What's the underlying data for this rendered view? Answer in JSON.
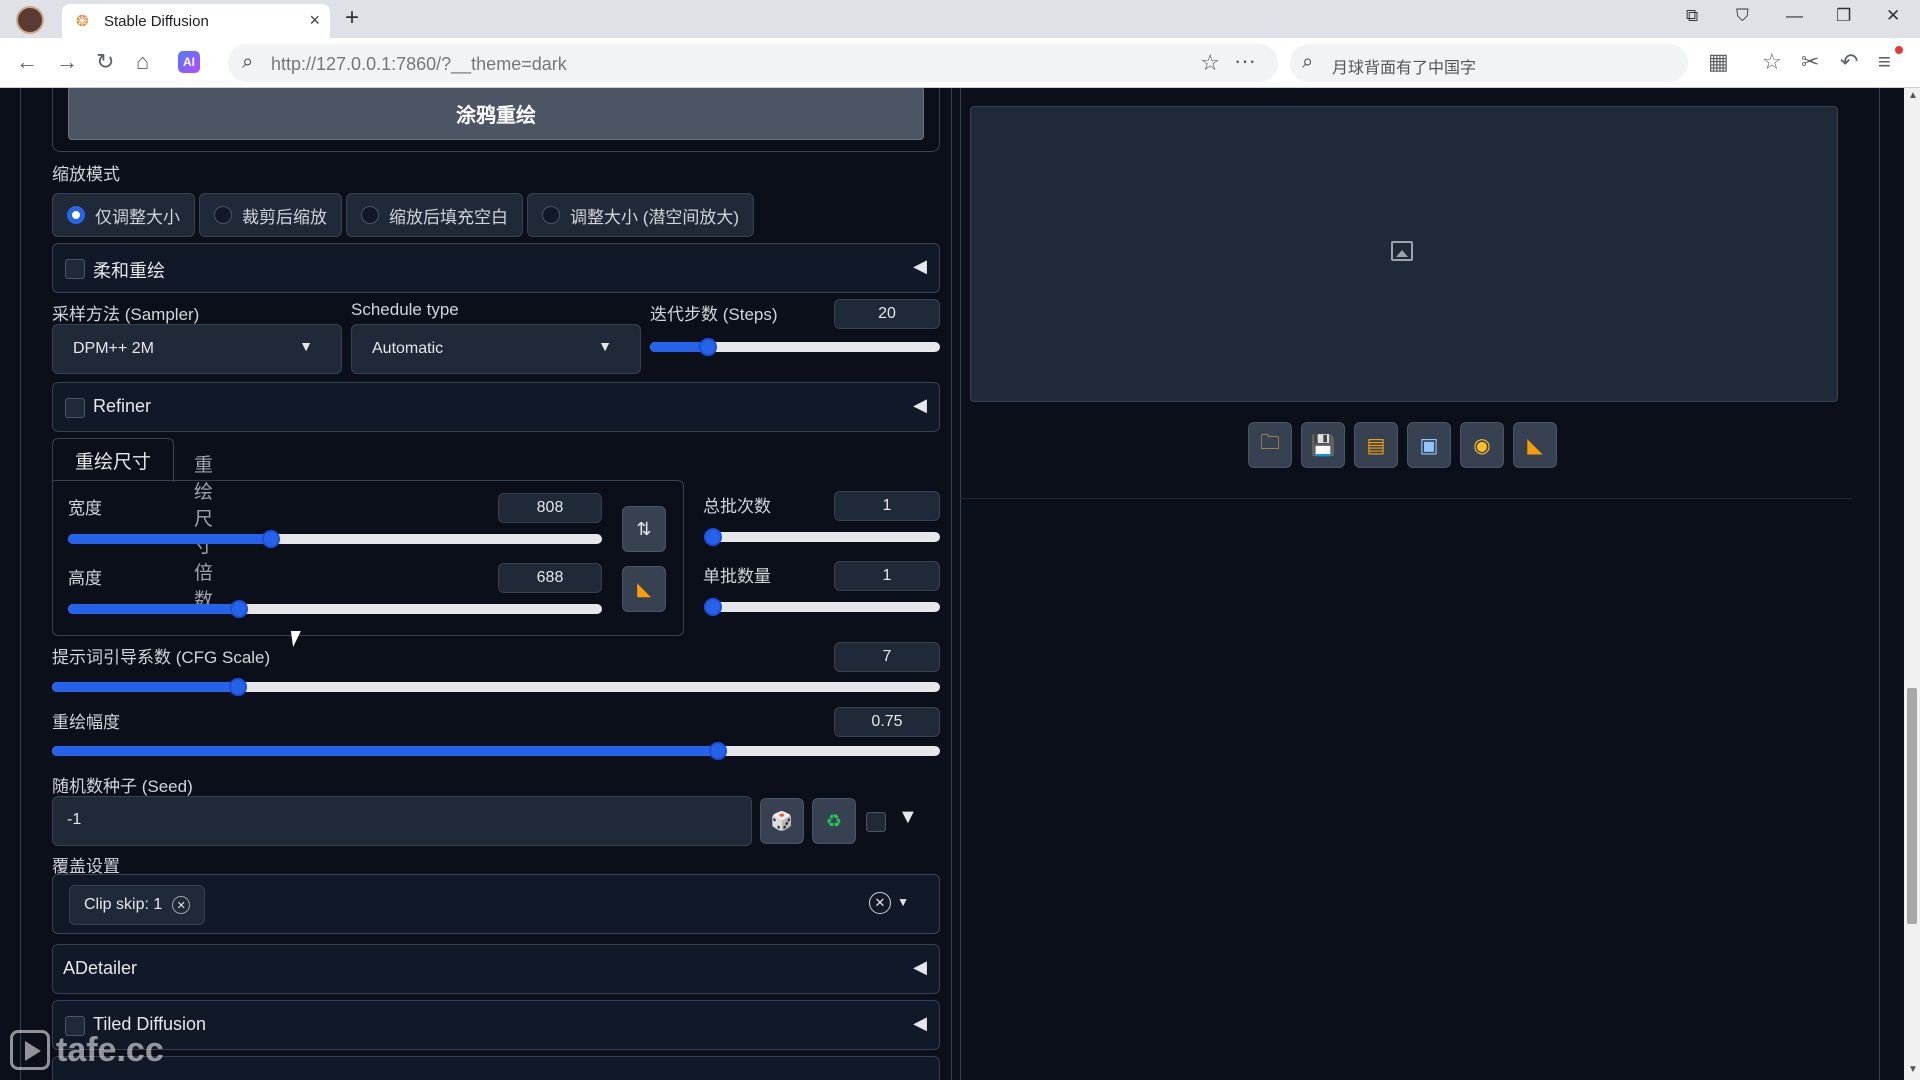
{
  "browser": {
    "tab_title": "Stable Diffusion",
    "tab_icon": "sd-icon",
    "url": "http://127.0.0.1:7860/?__theme=dark",
    "search_placeholder": "月球背面有了中国字",
    "ai_label": "AI"
  },
  "img2img": {
    "inpaint_button": "涂鸦重绘",
    "resize_mode_label": "缩放模式",
    "resize_modes": [
      "仅调整大小",
      "裁剪后缩放",
      "缩放后填充空白",
      "调整大小 (潜空间放大)"
    ],
    "resize_mode_selected": 0,
    "soft_inpaint": "柔和重绘",
    "sampler_label": "采样方法 (Sampler)",
    "sampler_value": "DPM++ 2M",
    "schedule_label": "Schedule type",
    "schedule_value": "Automatic",
    "steps_label": "迭代步数 (Steps)",
    "steps_value": "20",
    "steps_fraction": 0.2,
    "refiner": "Refiner",
    "tab_size": "重绘尺寸",
    "tab_scale": "重绘尺寸倍数",
    "width_label": "宽度",
    "width_value": "808",
    "width_fraction": 0.38,
    "height_label": "高度",
    "height_value": "688",
    "height_fraction": 0.32,
    "batch_count_label": "总批次数",
    "batch_count_value": "1",
    "batch_count_fraction": 0.0,
    "batch_size_label": "单批数量",
    "batch_size_value": "1",
    "batch_size_fraction": 0.0,
    "cfg_label": "提示词引导系数 (CFG Scale)",
    "cfg_value": "7",
    "cfg_fraction": 0.21,
    "denoise_label": "重绘幅度",
    "denoise_value": "0.75",
    "denoise_fraction": 0.75,
    "seed_label": "随机数种子 (Seed)",
    "seed_value": "-1",
    "override_label": "覆盖设置",
    "override_chip": "Clip skip: 1",
    "adetailer": "ADetailer",
    "tiled_diffusion": "Tiled Diffusion"
  },
  "watermark": "tafe.cc",
  "colors": {
    "accent": "#2563eb",
    "panel": "#1f2937",
    "background": "#0b0f19"
  }
}
